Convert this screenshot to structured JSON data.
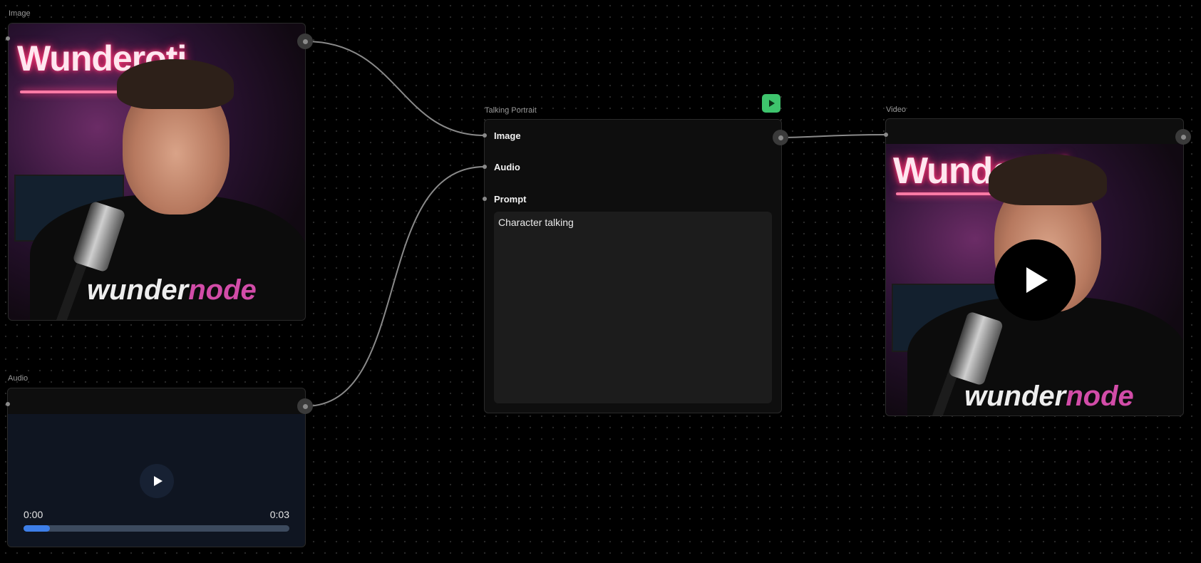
{
  "nodes": {
    "image": {
      "title": "Image",
      "neon_sign": "Wunderoti",
      "shirt_logo_word1": "wunder",
      "shirt_logo_word2": "node"
    },
    "audio": {
      "title": "Audio",
      "time_current": "0:00",
      "time_total": "0:03",
      "progress_fraction": 0.1
    },
    "talking_portrait": {
      "title": "Talking Portrait",
      "inputs": {
        "image_label": "Image",
        "audio_label": "Audio",
        "prompt_label": "Prompt"
      },
      "prompt_value": "Character talking"
    },
    "video": {
      "title": "Video",
      "neon_sign": "Wunderoti",
      "shirt_logo_word1": "wunder",
      "shirt_logo_word2": "node"
    }
  },
  "colors": {
    "run_button": "#3ec46d",
    "audio_progress": "#3d7ee8",
    "shirt_logo_accent": "#d24ca8",
    "neon_glow": "#ff3a7a"
  },
  "icons": {
    "run": "play-icon",
    "video_play": "play-icon",
    "audio_play": "play-icon"
  }
}
